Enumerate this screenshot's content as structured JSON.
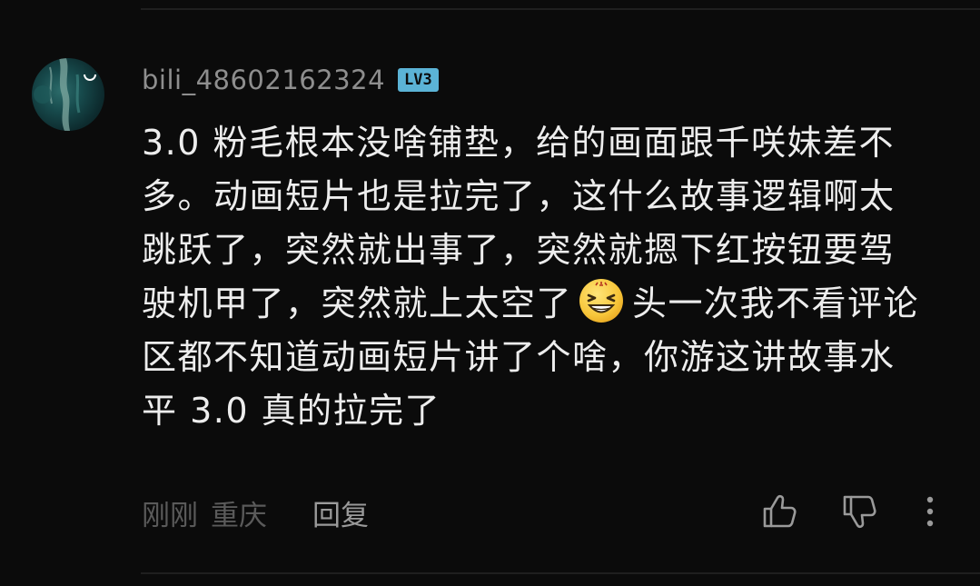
{
  "comment": {
    "username": "bili_48602162324",
    "level_badge": "LV3",
    "lines": [
      "3.0 粉毛根本没啥铺垫，给的画面跟千咲妹差不",
      "多。动画短片也是拉完了，这什么故事逻辑啊太",
      "跳跃了，突然就出事了，突然就摁下红按钮要驾",
      "驶机甲了，突然就上太空了",
      "头一次我不看评论",
      "区都不知道动画短片讲了个啥，你游这讲故事水",
      "平 3.0 真的拉完了"
    ],
    "emoji": "grinning-squint-face-emoji",
    "time": "刚刚",
    "location": "重庆",
    "reply_label": "回复"
  },
  "icons": {
    "like": "thumbs-up-icon",
    "dislike": "thumbs-down-icon",
    "more": "more-vertical-icon"
  },
  "colors": {
    "background": "#0b0b0b",
    "text": "#ededed",
    "username": "#8e8e8e",
    "meta": "#5a5a5a",
    "badge": "#5bb3d6"
  }
}
